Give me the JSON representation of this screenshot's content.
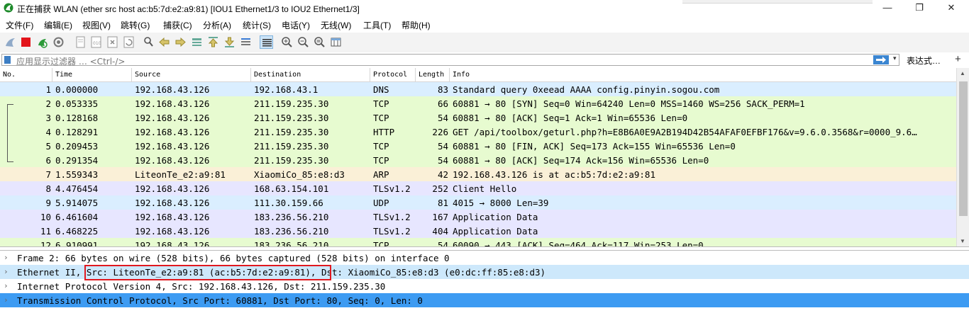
{
  "window": {
    "title": "正在捕获 WLAN (ether src host ac:b5:7d:e2:a9:81) [IOU1 Ethernet1/3 to IOU2 Ethernet1/3]",
    "minimize": "—",
    "maximize": "❐",
    "close": "✕"
  },
  "menu": [
    "文件(F)",
    "编辑(E)",
    "视图(V)",
    "跳转(G)",
    "捕获(C)",
    "分析(A)",
    "统计(S)",
    "电话(Y)",
    "无线(W)",
    "工具(T)",
    "帮助(H)"
  ],
  "filter": {
    "placeholder": "应用显示过滤器 … <Ctrl-/>",
    "expression_label": "表达式…",
    "add_label": "+",
    "dropdown": "▾"
  },
  "colors": {
    "udp_blue": "#daeeff",
    "tcp_green": "#e7fbd0",
    "arp_tan": "#faf0d7",
    "tls_lavender": "#e7e6ff",
    "selected_blue": "#3d9bf2",
    "hover_blue": "#cde8fb",
    "highlight_red": "#e0191f"
  },
  "packet_list": {
    "columns": [
      "No.",
      "Time",
      "Source",
      "Destination",
      "Protocol",
      "Length",
      "Info"
    ],
    "rows": [
      {
        "no": "1",
        "time": "0.000000",
        "source": "192.168.43.126",
        "destination": "192.168.43.1",
        "protocol": "DNS",
        "length": "83",
        "info": "Standard query 0xeead AAAA config.pinyin.sogou.com",
        "bg": "#daeeff"
      },
      {
        "no": "2",
        "time": "0.053335",
        "source": "192.168.43.126",
        "destination": "211.159.235.30",
        "protocol": "TCP",
        "length": "66",
        "info": "60881 → 80 [SYN] Seq=0 Win=64240 Len=0 MSS=1460 WS=256 SACK_PERM=1",
        "bg": "#e7fbd0"
      },
      {
        "no": "3",
        "time": "0.128168",
        "source": "192.168.43.126",
        "destination": "211.159.235.30",
        "protocol": "TCP",
        "length": "54",
        "info": "60881 → 80 [ACK] Seq=1 Ack=1 Win=65536 Len=0",
        "bg": "#e7fbd0"
      },
      {
        "no": "4",
        "time": "0.128291",
        "source": "192.168.43.126",
        "destination": "211.159.235.30",
        "protocol": "HTTP",
        "length": "226",
        "info": "GET /api/toolbox/geturl.php?h=E8B6A0E9A2B194D42B54AFAF0EFBF176&v=9.6.0.3568&r=0000_9.6…",
        "bg": "#e7fbd0"
      },
      {
        "no": "5",
        "time": "0.209453",
        "source": "192.168.43.126",
        "destination": "211.159.235.30",
        "protocol": "TCP",
        "length": "54",
        "info": "60881 → 80 [FIN, ACK] Seq=173 Ack=155 Win=65536 Len=0",
        "bg": "#e7fbd0"
      },
      {
        "no": "6",
        "time": "0.291354",
        "source": "192.168.43.126",
        "destination": "211.159.235.30",
        "protocol": "TCP",
        "length": "54",
        "info": "60881 → 80 [ACK] Seq=174 Ack=156 Win=65536 Len=0",
        "bg": "#e7fbd0"
      },
      {
        "no": "7",
        "time": "1.559343",
        "source": "LiteonTe_e2:a9:81",
        "destination": "XiaomiCo_85:e8:d3",
        "protocol": "ARP",
        "length": "42",
        "info": "192.168.43.126 is at ac:b5:7d:e2:a9:81",
        "bg": "#faf0d7"
      },
      {
        "no": "8",
        "time": "4.476454",
        "source": "192.168.43.126",
        "destination": "168.63.154.101",
        "protocol": "TLSv1.2",
        "length": "252",
        "info": "Client Hello",
        "bg": "#e7e6ff"
      },
      {
        "no": "9",
        "time": "5.914075",
        "source": "192.168.43.126",
        "destination": "111.30.159.66",
        "protocol": "UDP",
        "length": "81",
        "info": "4015 → 8000 Len=39",
        "bg": "#daeeff"
      },
      {
        "no": "10",
        "time": "6.461604",
        "source": "192.168.43.126",
        "destination": "183.236.56.210",
        "protocol": "TLSv1.2",
        "length": "167",
        "info": "Application Data",
        "bg": "#e7e6ff"
      },
      {
        "no": "11",
        "time": "6.468225",
        "source": "192.168.43.126",
        "destination": "183.236.56.210",
        "protocol": "TLSv1.2",
        "length": "404",
        "info": "Application Data",
        "bg": "#e7e6ff"
      },
      {
        "no": "12",
        "time": "6.910991",
        "source": "192.168.43.126",
        "destination": "183.236.56.210",
        "protocol": "TCP",
        "length": "54",
        "info": "60090 → 443 [ACK] Seq=464 Ack=117 Win=253 Len=0",
        "bg": "#e7fbd0"
      }
    ]
  },
  "details": [
    {
      "text": "Frame 2: 66 bytes on wire (528 bits), 66 bytes captured (528 bits) on interface 0",
      "bg": "#ffffff",
      "color": "#000000"
    },
    {
      "text": "Ethernet II, Src: LiteonTe_e2:a9:81 (ac:b5:7d:e2:a9:81), Dst: XiaomiCo_85:e8:d3 (e0:dc:ff:85:e8:d3)",
      "bg": "#cde8fb",
      "color": "#000000"
    },
    {
      "text": "Internet Protocol Version 4, Src: 192.168.43.126, Dst: 211.159.235.30",
      "bg": "#ffffff",
      "color": "#000000"
    },
    {
      "text": "Transmission Control Protocol, Src Port: 60881, Dst Port: 80, Seq: 0, Len: 0",
      "bg": "#3d9bf2",
      "color": "#000000"
    }
  ],
  "toolbar_icons": [
    "fin-icon",
    "stop-icon",
    "restart-icon",
    "options-icon",
    "open-icon",
    "save-icon",
    "close-file-icon",
    "reload-icon",
    "find-icon",
    "go-back-icon",
    "go-forward-icon",
    "go-to-packet-icon",
    "first-packet-icon",
    "last-packet-icon",
    "autoscroll-icon",
    "colorize-icon",
    "zoom-in-icon",
    "zoom-out-icon",
    "normal-size-icon",
    "resize-columns-icon"
  ]
}
